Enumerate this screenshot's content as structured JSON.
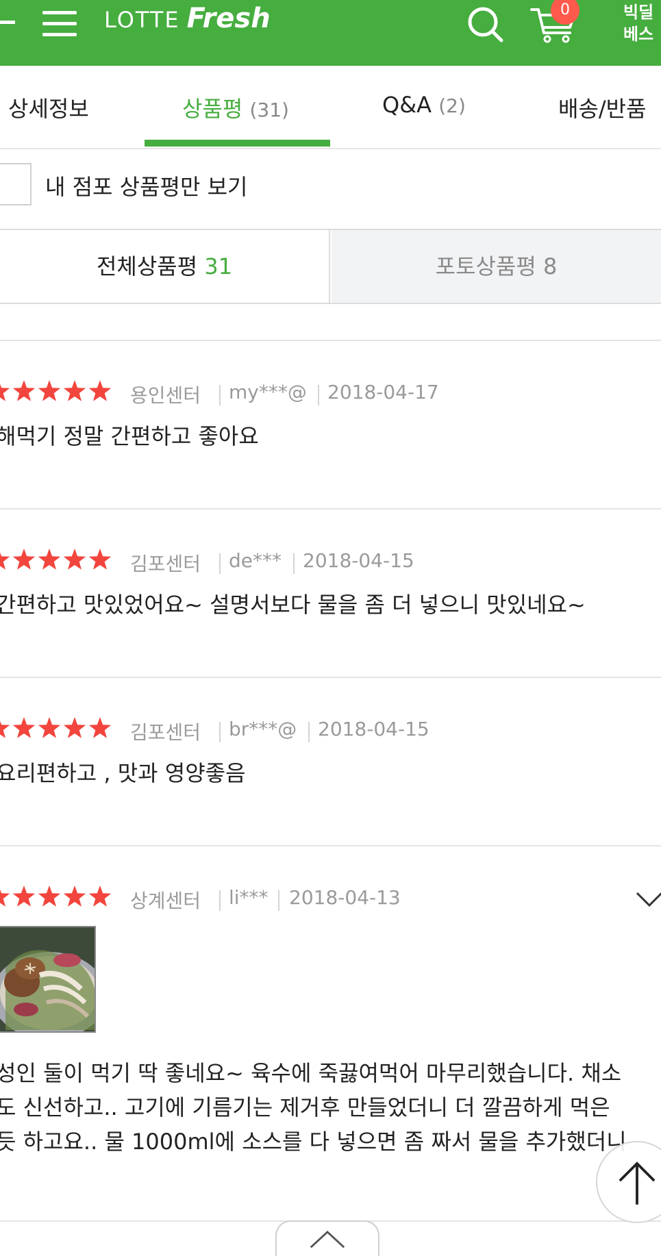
{
  "header": {
    "logo_lotte": "LOTTE",
    "logo_fresh": "Fresh",
    "cart_count": "0",
    "right_link": "빅딜\n베스",
    "brand_color": "#46ad3f"
  },
  "tabs": [
    {
      "label": "상세정보",
      "count": ""
    },
    {
      "label": "상품평",
      "count": "(31)"
    },
    {
      "label": "Q&A",
      "count": "(2)"
    },
    {
      "label": "배송/반품",
      "count": ""
    }
  ],
  "filter": {
    "label": "내 점포 상품평만 보기"
  },
  "subtabs": {
    "all_label": "전체상품평",
    "all_count": "31",
    "photo_label": "포토상품평",
    "photo_count": "8"
  },
  "reviews": [
    {
      "rating": 5,
      "center": "용인센터",
      "user": "my***@",
      "date": "2018-04-17",
      "lines": [
        "해먹기 정말 간편하고 좋아요"
      ]
    },
    {
      "rating": 5,
      "center": "김포센터",
      "user": "de***",
      "date": "2018-04-15",
      "lines": [
        "간편하고 맛있었어요~ 설명서보다 물을 좀 더 넣으니 맛있네요~"
      ]
    },
    {
      "rating": 5,
      "center": "김포센터",
      "user": "br***@",
      "date": "2018-04-15",
      "lines": [
        "요리편하고 , 맛과 영양좋음"
      ]
    },
    {
      "rating": 5,
      "center": "상계센터",
      "user": "li***",
      "date": "2018-04-13",
      "lines": [
        "성인 둘이 먹기 딱 좋네요~ 육수에 죽끓여먹어 마무리했습니다. 채소",
        "도 신선하고.. 고기에 기름기는 제거후 만들었더니 더 깔끔하게 먹은",
        "듯 하고요.. 물 1000ml에 소스를 다 넣으면 좀 짜서 물을 추가했더니"
      ]
    }
  ],
  "star_color": "#f2453d"
}
